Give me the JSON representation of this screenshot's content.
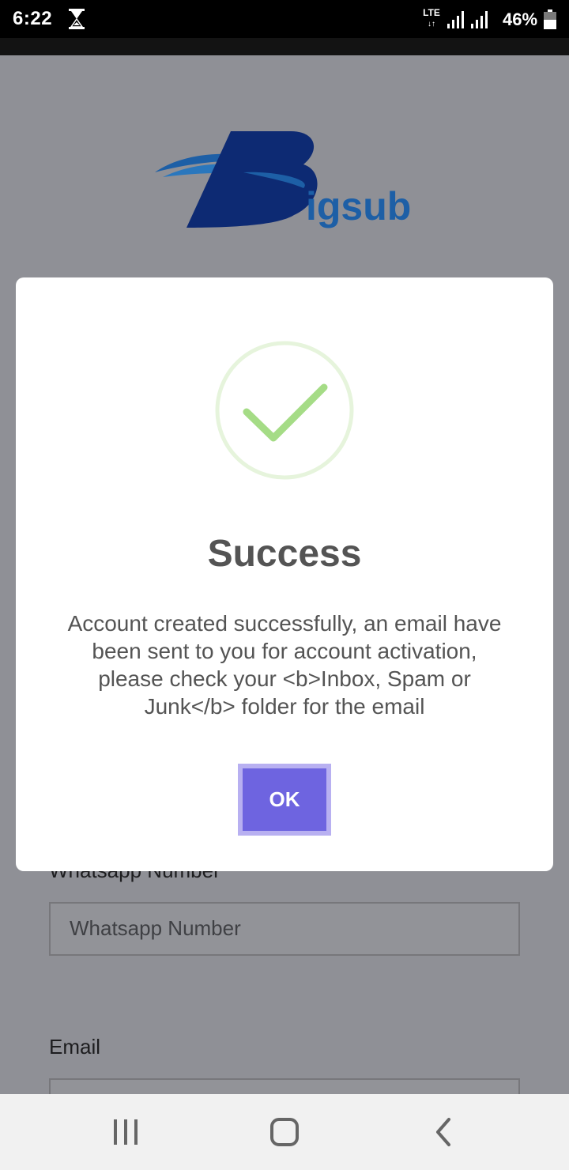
{
  "status_bar": {
    "time": "6:22",
    "network": "LTE",
    "battery": "46%",
    "icons": [
      "hourglass-icon",
      "lte-icon",
      "signal-icon",
      "signal-icon",
      "battery-icon"
    ]
  },
  "logo": {
    "text": "Bigsub"
  },
  "form": {
    "whatsapp_label": "Whatsapp Number",
    "whatsapp_placeholder": "Whatsapp Number",
    "email_label": "Email"
  },
  "modal": {
    "icon": "checkmark-circle-icon",
    "title": "Success",
    "message": "Account created successfully, an email have been sent to you for account activation, please check your <b>Inbox, Spam or Junk</b> folder for the email",
    "ok_label": "OK"
  },
  "nav_bar": {
    "icons": [
      "recents-icon",
      "home-icon",
      "back-icon"
    ]
  },
  "colors": {
    "overlay_background": "#8f9096",
    "ok_button": "#6e64e0",
    "ok_button_focus_ring": "#b8b0f1",
    "success_green": "#a5dc86",
    "logo_navy": "#0d2a73",
    "logo_blue": "#1d5fa6"
  }
}
